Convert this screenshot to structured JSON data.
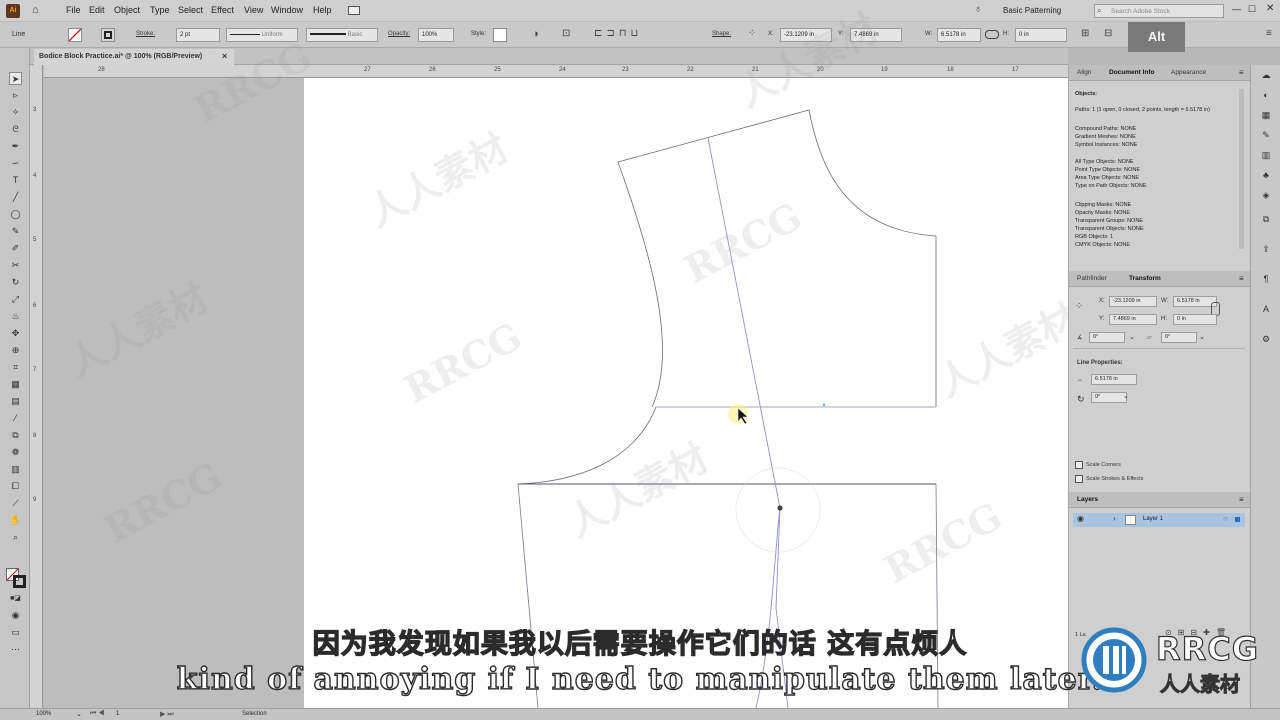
{
  "app": {
    "badge": "Ai"
  },
  "menu": [
    "File",
    "Edit",
    "Object",
    "Type",
    "Select",
    "Effect",
    "View",
    "Window",
    "Help"
  ],
  "workspace": "Basic Patterning",
  "search_placeholder": "Search Adobe Stock",
  "control": {
    "selection_type": "Line",
    "stroke_label": "Stroke:",
    "stroke_weight": "2 pt",
    "profile1": "Uniform",
    "profile2": "Basic",
    "opacity_label": "Opacity:",
    "opacity": "100%",
    "style_label": "Style:",
    "shape_label": "Shape:",
    "x_label": "X:",
    "x": "-23.1209 in",
    "y_label": "Y:",
    "y": "7.4869 in",
    "w_label": "W:",
    "w": "6.5178 in",
    "h_label": "H:",
    "h": "0 in"
  },
  "alt_badge": "Alt",
  "document_tab": {
    "title": "Bodice Block Practice.ai* @ 100% (RGB/Preview)",
    "close": "×"
  },
  "ruler_h": [
    "28",
    "27",
    "26",
    "25",
    "24",
    "23",
    "22",
    "21",
    "20",
    "19",
    "18",
    "17"
  ],
  "ruler_v": [
    "3",
    "4",
    "5",
    "6",
    "7",
    "8",
    "9"
  ],
  "panel_top": {
    "tabs": [
      "Align",
      "Document Info",
      "Appearance"
    ],
    "objects_heading": "Objects:",
    "lines": [
      "Paths: 1 (1 open, 0 closed, 2 points, length = 6.5178 in)",
      "Compound Paths: NONE",
      "Gradient Meshes: NONE",
      "Symbol Instances: NONE",
      "",
      "All Type Objects: NONE",
      "Point Type Objects: NONE",
      "Area Type Objects: NONE",
      "Type on Path Objects: NONE",
      "",
      "Clipping Masks: NONE",
      "Opacity Masks: NONE",
      "Transparent Groups: NONE",
      "Transparent Objects: NONE",
      "RGB Objects: 1",
      "CMYK Objects: NONE"
    ]
  },
  "transform_panel": {
    "tabs": [
      "Pathfinder",
      "Transform"
    ],
    "x_label": "X:",
    "x": "-23.1209 in",
    "y_label": "Y:",
    "y": "7.4869 in",
    "w_label": "W:",
    "w": "6.5178 in",
    "h_label": "H:",
    "h": "0 in",
    "angle": "0°",
    "shear": "0°",
    "line_properties": "Line Properties:",
    "length": "6.5178 in",
    "line_angle": "0°",
    "scale_corners": "Scale Corners",
    "scale_strokes": "Scale Strokes & Effects"
  },
  "layers_panel": {
    "tab": "Layers",
    "layers": [
      {
        "name": "Layer 1"
      }
    ],
    "count": "1 La"
  },
  "status": {
    "zoom": "100%",
    "artboard": "1",
    "tool": "Selection"
  },
  "subtitles": {
    "cn": "因为我发现如果我以后需要操作它们的话 这有点烦人",
    "en": "kind of annoying if I need to manipulate them later."
  },
  "watermark": {
    "text1": "RRCG",
    "text2": "人人素材"
  },
  "logo": {
    "text1": "RRCG",
    "text2": "人人素材"
  },
  "colors": {
    "accent": "#2f7fc0",
    "ui_bg": "#cfcfcf",
    "artboard": "#ffffff",
    "subtitle_stroke": "#2b2b2b"
  }
}
